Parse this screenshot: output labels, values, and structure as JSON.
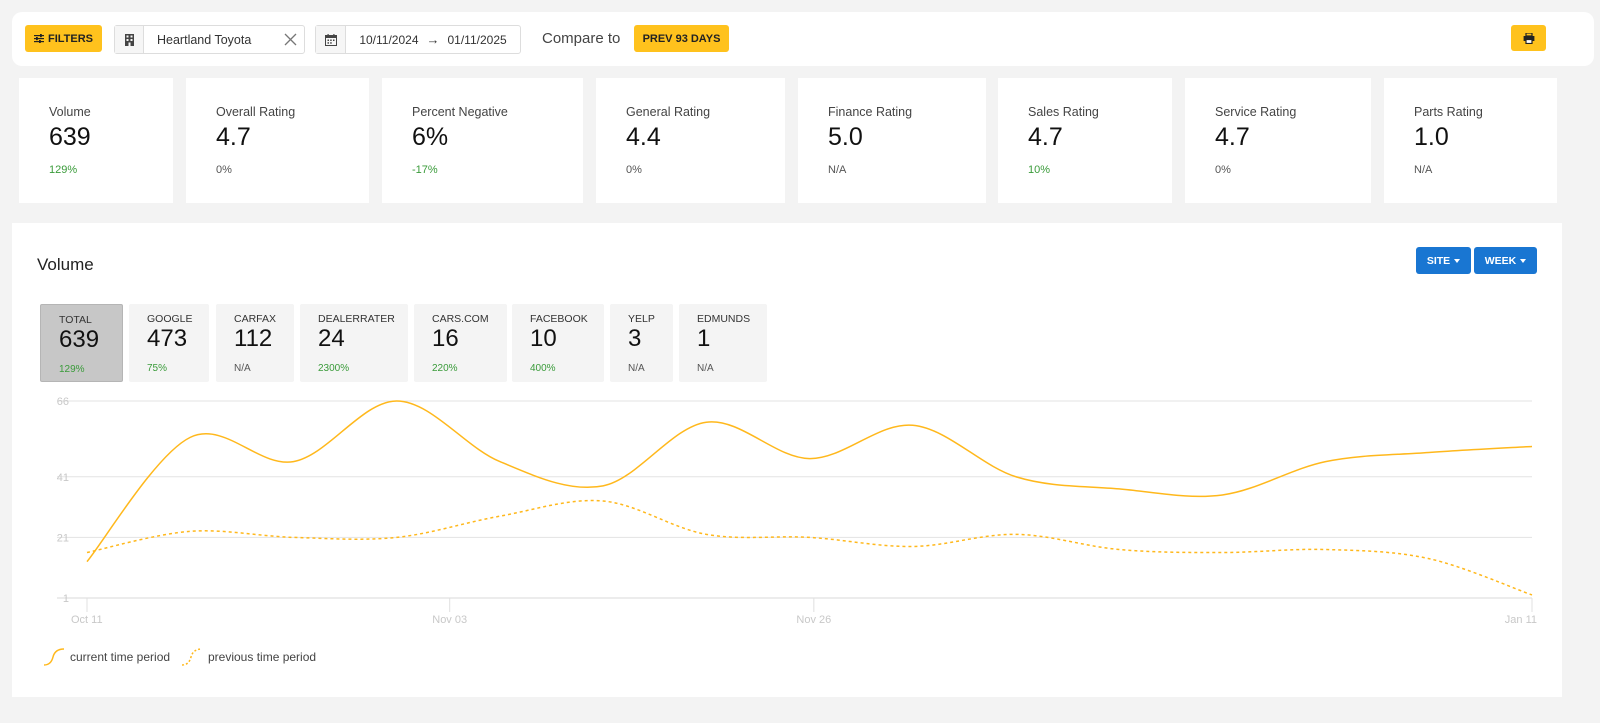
{
  "toolbar": {
    "filters_label": "FILTERS",
    "dealer": "Heartland Toyota",
    "date_from": "10/11/2024",
    "date_arrow": "→",
    "date_to": "01/11/2025",
    "compare_label": "Compare to",
    "prev_label": "PREV 93 DAYS"
  },
  "stats": [
    {
      "label": "Volume",
      "value": "639",
      "delta": "129%"
    },
    {
      "label": "Overall Rating",
      "value": "4.7",
      "delta": "0%"
    },
    {
      "label": "Percent Negative",
      "value": "6%",
      "delta": "-17%"
    },
    {
      "label": "General Rating",
      "value": "4.4",
      "delta": "0%"
    },
    {
      "label": "Finance Rating",
      "value": "5.0",
      "delta": "N/A"
    },
    {
      "label": "Sales Rating",
      "value": "4.7",
      "delta": "10%"
    },
    {
      "label": "Service Rating",
      "value": "4.7",
      "delta": "0%"
    },
    {
      "label": "Parts Rating",
      "value": "1.0",
      "delta": "N/A"
    }
  ],
  "volume": {
    "title": "Volume",
    "site_label": "SITE",
    "week_label": "WEEK",
    "sources": [
      {
        "name": "TOTAL",
        "value": "639",
        "delta": "129%"
      },
      {
        "name": "GOOGLE",
        "value": "473",
        "delta": "75%"
      },
      {
        "name": "CARFAX",
        "value": "112",
        "delta": "N/A"
      },
      {
        "name": "DEALERRATER",
        "value": "24",
        "delta": "2300%"
      },
      {
        "name": "CARS.COM",
        "value": "16",
        "delta": "220%"
      },
      {
        "name": "FACEBOOK",
        "value": "10",
        "delta": "400%"
      },
      {
        "name": "YELP",
        "value": "3",
        "delta": "N/A"
      },
      {
        "name": "EDMUNDS",
        "value": "1",
        "delta": "N/A"
      }
    ]
  },
  "chart_data": {
    "type": "line",
    "x_ticks": [
      "Oct 11",
      "Nov 03",
      "Nov 26",
      "Jan 11"
    ],
    "y_ticks": [
      1,
      21,
      41,
      66
    ],
    "ylim": [
      1,
      66
    ],
    "x": [
      "Oct 11",
      "Oct 13",
      "Oct 21",
      "Oct 28",
      "Nov 03",
      "Nov 09",
      "Nov 14",
      "Nov 20",
      "Nov 26",
      "Dec 02",
      "Dec 08",
      "Dec 18",
      "Dec 25",
      "Dec 31",
      "Jan 11"
    ],
    "series": [
      {
        "name": "current time period",
        "style": "solid",
        "color": "#ffb81c",
        "values": [
          13,
          54,
          46,
          66,
          46,
          38,
          59,
          47,
          58,
          41,
          37,
          35,
          46,
          49,
          51
        ]
      },
      {
        "name": "previous time period",
        "style": "dashed",
        "color": "#ffb81c",
        "values": [
          16,
          23,
          21,
          21,
          28,
          33,
          22,
          21,
          18,
          22,
          17,
          16,
          17,
          14,
          2
        ]
      }
    ],
    "grid": true,
    "legend": "bottom-left"
  }
}
